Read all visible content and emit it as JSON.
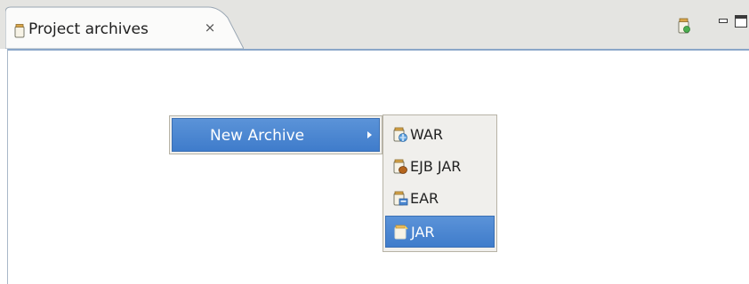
{
  "view": {
    "tab_title": "Project archives",
    "close_glyph": "⨯",
    "icons": {
      "tab": "jar-icon",
      "toolbar": "build-archive-icon",
      "minimize": "minimize-icon",
      "maximize": "maximize-icon"
    }
  },
  "context_menu": {
    "new_archive_label": "New Archive",
    "submenu": [
      {
        "label": "WAR",
        "icon": "war-archive-icon",
        "selected": false
      },
      {
        "label": "EJB JAR",
        "icon": "ejb-jar-archive-icon",
        "selected": false
      },
      {
        "label": "EAR",
        "icon": "ear-archive-icon",
        "selected": false
      },
      {
        "label": "JAR",
        "icon": "jar-archive-icon",
        "selected": true
      }
    ]
  },
  "colors": {
    "selection": "#4a86d0",
    "menu_bg": "#f0efec",
    "tabbar_bg": "#e4e4e1"
  }
}
